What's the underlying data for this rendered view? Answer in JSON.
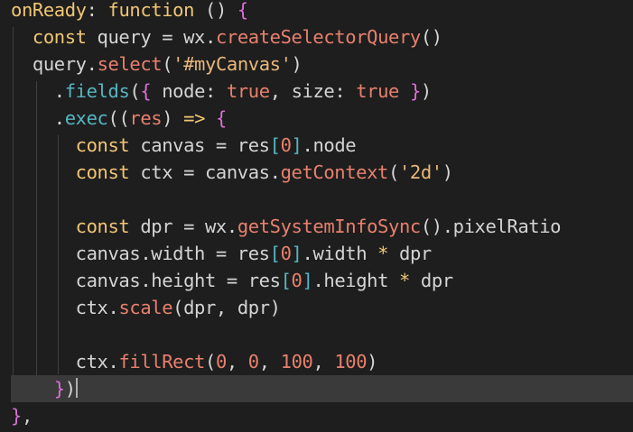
{
  "theme": {
    "background": "#1e1e1e",
    "current_line": "#3a3a3a",
    "colors": {
      "keyword": "#f0c674",
      "ident": "#d4d4d4",
      "prop": "#56b6c2",
      "func": "#e8806e",
      "str": "#e8b87a",
      "num": "#e8806e",
      "bool": "#e8806e",
      "brace": "#da70d6",
      "paren": "#d4d4d4",
      "bracket": "#56b6c2",
      "punct": "#d4d4d4"
    }
  },
  "lines": [
    [
      [
        "keyword",
        "onReady"
      ],
      [
        "punct",
        ": "
      ],
      [
        "keyword",
        "function"
      ],
      [
        "ident",
        " "
      ],
      [
        "paren",
        "()"
      ],
      [
        "ident",
        " "
      ],
      [
        "brace",
        "{"
      ]
    ],
    [
      [
        "ident",
        "  "
      ],
      [
        "keyword",
        "const"
      ],
      [
        "ident",
        " query = "
      ],
      [
        "ident",
        "wx"
      ],
      [
        "punct",
        "."
      ],
      [
        "func",
        "createSelectorQuery"
      ],
      [
        "paren",
        "()"
      ]
    ],
    [
      [
        "ident",
        "  "
      ],
      [
        "ident",
        "query"
      ],
      [
        "punct",
        "."
      ],
      [
        "func",
        "select"
      ],
      [
        "paren",
        "("
      ],
      [
        "str",
        "'#myCanvas'"
      ],
      [
        "paren",
        ")"
      ]
    ],
    [
      [
        "ident",
        "    "
      ],
      [
        "punct",
        "."
      ],
      [
        "prop",
        "fields"
      ],
      [
        "paren",
        "("
      ],
      [
        "brace",
        "{"
      ],
      [
        "ident",
        " node: "
      ],
      [
        "bool",
        "true"
      ],
      [
        "ident",
        ", size: "
      ],
      [
        "bool",
        "true"
      ],
      [
        "ident",
        " "
      ],
      [
        "brace",
        "}"
      ],
      [
        "paren",
        ")"
      ]
    ],
    [
      [
        "ident",
        "    "
      ],
      [
        "punct",
        "."
      ],
      [
        "prop",
        "exec"
      ],
      [
        "paren",
        "("
      ],
      [
        "paren",
        "("
      ],
      [
        "func",
        "res"
      ],
      [
        "paren",
        ")"
      ],
      [
        "ident",
        " "
      ],
      [
        "keyword",
        "=>"
      ],
      [
        "ident",
        " "
      ],
      [
        "brace",
        "{"
      ]
    ],
    [
      [
        "ident",
        "      "
      ],
      [
        "keyword",
        "const"
      ],
      [
        "ident",
        " canvas = res"
      ],
      [
        "bracket",
        "["
      ],
      [
        "num",
        "0"
      ],
      [
        "bracket",
        "]"
      ],
      [
        "punct",
        "."
      ],
      [
        "ident",
        "node"
      ]
    ],
    [
      [
        "ident",
        "      "
      ],
      [
        "keyword",
        "const"
      ],
      [
        "ident",
        " ctx = canvas"
      ],
      [
        "punct",
        "."
      ],
      [
        "func",
        "getContext"
      ],
      [
        "paren",
        "("
      ],
      [
        "str",
        "'2d'"
      ],
      [
        "paren",
        ")"
      ]
    ],
    [],
    [
      [
        "ident",
        "      "
      ],
      [
        "keyword",
        "const"
      ],
      [
        "ident",
        " dpr = wx"
      ],
      [
        "punct",
        "."
      ],
      [
        "func",
        "getSystemInfoSync"
      ],
      [
        "paren",
        "()"
      ],
      [
        "punct",
        "."
      ],
      [
        "ident",
        "pixelRatio"
      ]
    ],
    [
      [
        "ident",
        "      canvas"
      ],
      [
        "punct",
        "."
      ],
      [
        "ident",
        "width = res"
      ],
      [
        "bracket",
        "["
      ],
      [
        "num",
        "0"
      ],
      [
        "bracket",
        "]"
      ],
      [
        "punct",
        "."
      ],
      [
        "ident",
        "width "
      ],
      [
        "keyword",
        "*"
      ],
      [
        "ident",
        " dpr"
      ]
    ],
    [
      [
        "ident",
        "      canvas"
      ],
      [
        "punct",
        "."
      ],
      [
        "ident",
        "height = res"
      ],
      [
        "bracket",
        "["
      ],
      [
        "num",
        "0"
      ],
      [
        "bracket",
        "]"
      ],
      [
        "punct",
        "."
      ],
      [
        "ident",
        "height "
      ],
      [
        "keyword",
        "*"
      ],
      [
        "ident",
        " dpr"
      ]
    ],
    [
      [
        "ident",
        "      ctx"
      ],
      [
        "punct",
        "."
      ],
      [
        "func",
        "scale"
      ],
      [
        "paren",
        "("
      ],
      [
        "ident",
        "dpr, dpr"
      ],
      [
        "paren",
        ")"
      ]
    ],
    [],
    [
      [
        "ident",
        "      ctx"
      ],
      [
        "punct",
        "."
      ],
      [
        "func",
        "fillRect"
      ],
      [
        "paren",
        "("
      ],
      [
        "num",
        "0"
      ],
      [
        "ident",
        ", "
      ],
      [
        "num",
        "0"
      ],
      [
        "ident",
        ", "
      ],
      [
        "num",
        "100"
      ],
      [
        "ident",
        ", "
      ],
      [
        "num",
        "100"
      ],
      [
        "paren",
        ")"
      ]
    ],
    [
      [
        "ident",
        "    "
      ],
      [
        "brace",
        "}"
      ],
      [
        "paren",
        ")"
      ]
    ],
    [
      [
        "brace",
        "}"
      ],
      [
        "punct",
        ","
      ]
    ]
  ]
}
